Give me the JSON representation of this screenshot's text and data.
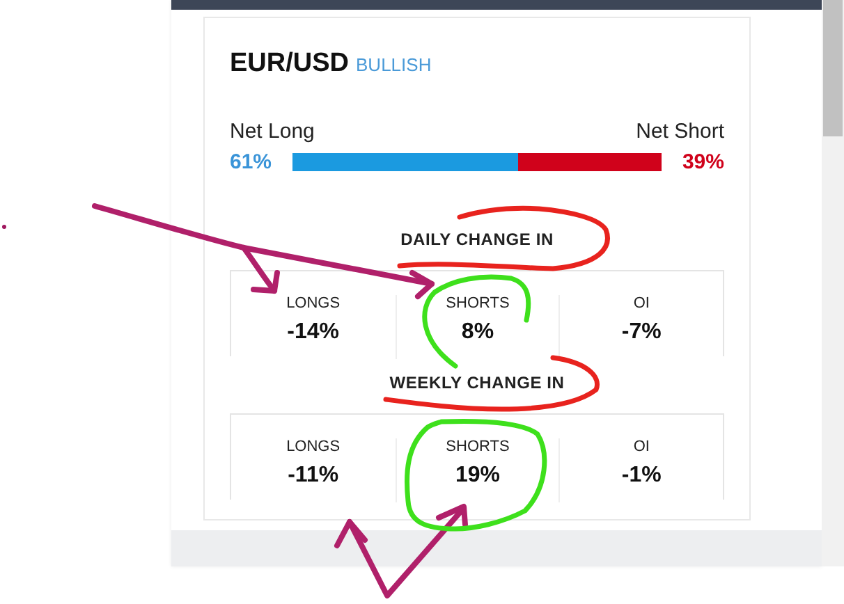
{
  "pair": {
    "symbol": "EUR/USD",
    "bias": "BULLISH"
  },
  "sentiment": {
    "long_label": "Net Long",
    "short_label": "Net Short",
    "long_value": "61%",
    "short_value": "39%",
    "level": 0.61
  },
  "sections": [
    {
      "title": "DAILY CHANGE IN",
      "stats": [
        {
          "label": "LONGS",
          "value": "-14%"
        },
        {
          "label": "SHORTS",
          "value": "8%"
        },
        {
          "label": "OI",
          "value": "-7%"
        }
      ]
    },
    {
      "title": "WEEKLY CHANGE IN",
      "stats": [
        {
          "label": "LONGS",
          "value": "-11%"
        },
        {
          "label": "SHORTS",
          "value": "19%"
        },
        {
          "label": "OI",
          "value": "-1%"
        }
      ]
    }
  ]
}
